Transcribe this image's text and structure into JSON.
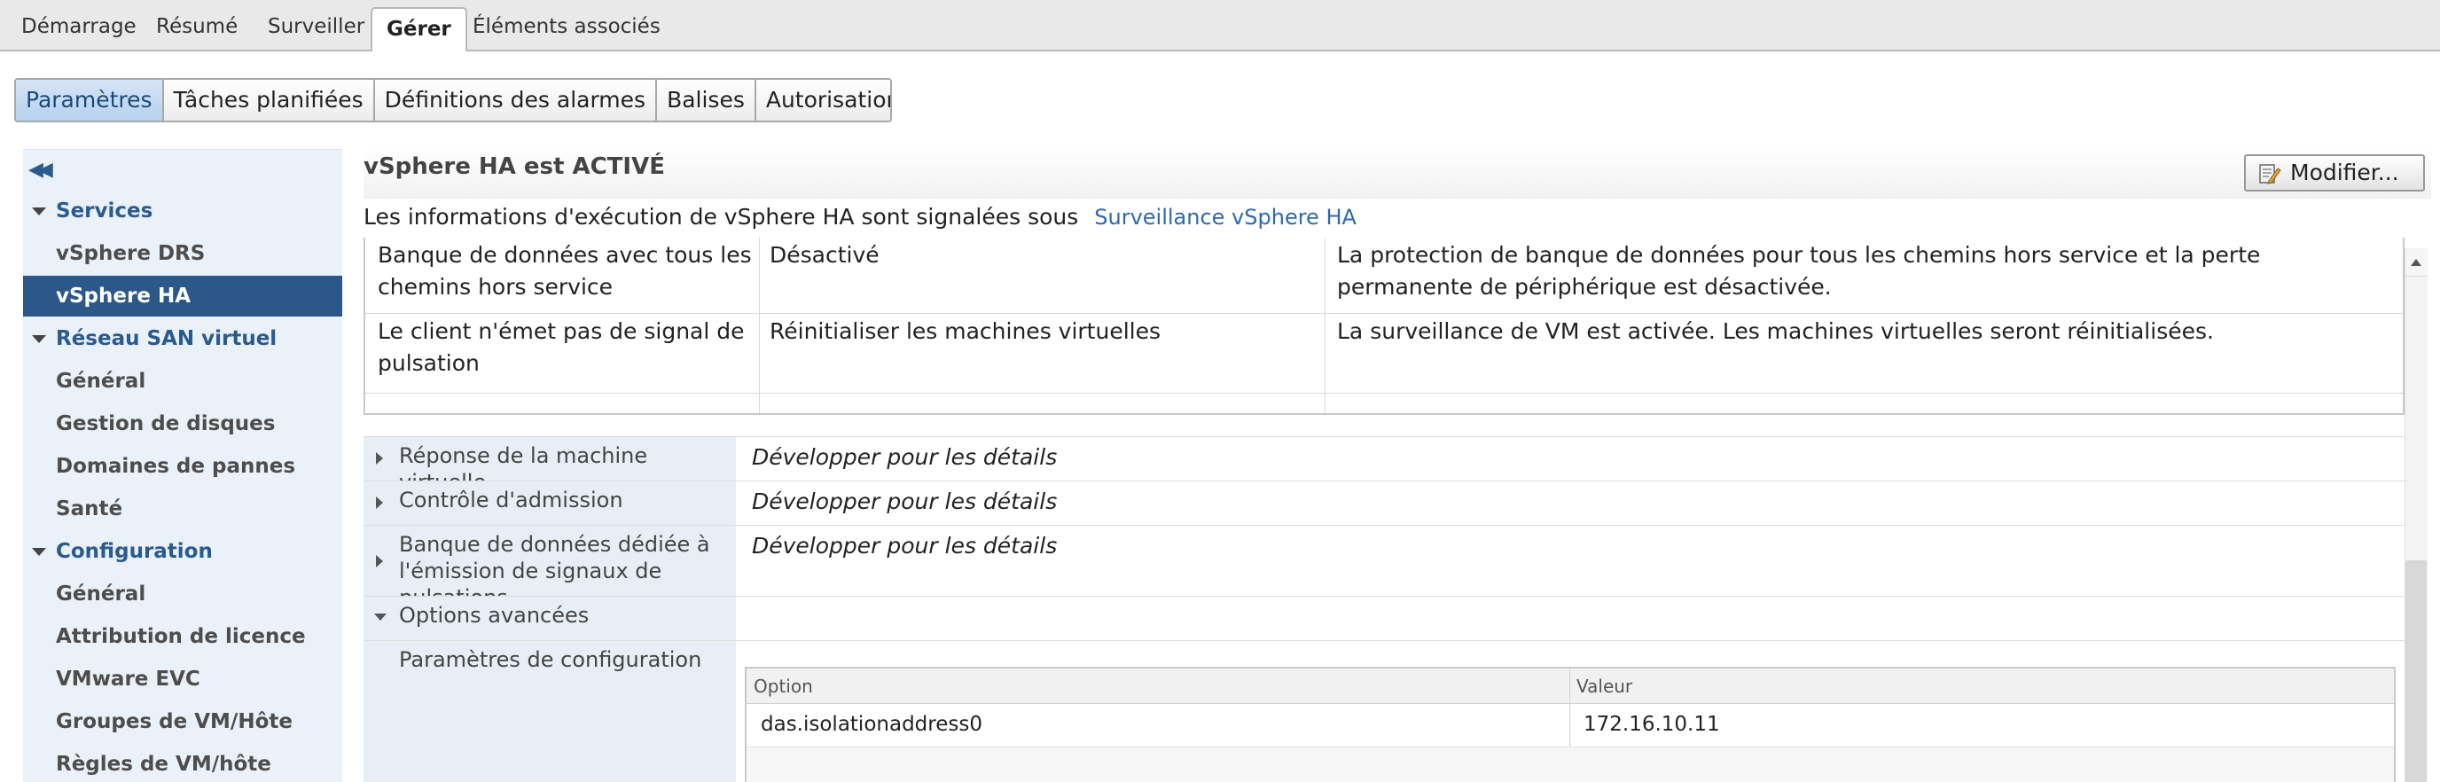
{
  "top_tabs": [
    "Démarrage",
    "Résumé",
    "Surveiller",
    "Gérer",
    "Éléments associés"
  ],
  "active_top_tab": "Gérer",
  "sub_tabs": [
    "Paramètres",
    "Tâches planifiées",
    "Définitions des alarmes",
    "Balises",
    "Autorisations"
  ],
  "active_sub_tab": "Paramètres",
  "sidebar": {
    "collapse_symbol": "◀◀",
    "items": [
      {
        "label": "Services",
        "kind": "group"
      },
      {
        "label": "vSphere DRS",
        "kind": "child"
      },
      {
        "label": "vSphere HA",
        "kind": "child",
        "selected": true
      },
      {
        "label": "Réseau SAN virtuel",
        "kind": "group"
      },
      {
        "label": "Général",
        "kind": "child"
      },
      {
        "label": "Gestion de disques",
        "kind": "child"
      },
      {
        "label": "Domaines de pannes",
        "kind": "child"
      },
      {
        "label": "Santé",
        "kind": "child"
      },
      {
        "label": "Configuration",
        "kind": "group"
      },
      {
        "label": "Général",
        "kind": "child"
      },
      {
        "label": "Attribution de licence",
        "kind": "child"
      },
      {
        "label": "VMware EVC",
        "kind": "child"
      },
      {
        "label": "Groupes de VM/Hôte",
        "kind": "child"
      },
      {
        "label": "Règles de VM/hôte",
        "kind": "child"
      }
    ]
  },
  "header": {
    "title": "vSphere HA est ACTIVÉ",
    "edit_button": "Modifier...",
    "info_text": "Les informations d'exécution de vSphere HA sont signalées sous",
    "info_link": "Surveillance vSphere HA"
  },
  "failure_table": {
    "rows": [
      {
        "condition": "Banque de données avec tous les chemins hors service",
        "response": "Désactivé",
        "details": "La protection de banque de données pour tous les chemins hors service et la perte permanente de périphérique est désactivée."
      },
      {
        "condition": "Le client n'émet pas de signal de pulsation",
        "response": "Réinitialiser les machines virtuelles",
        "details": "La surveillance de VM est activée. Les machines virtuelles seront réinitialisées."
      }
    ]
  },
  "properties": [
    {
      "label": "Réponse de la machine virtuelle",
      "value": "Développer pour les détails",
      "expanded": false
    },
    {
      "label": "Contrôle d'admission",
      "value": "Développer pour les détails",
      "expanded": false
    },
    {
      "label": "Banque de données dédiée à l'émission de signaux de pulsations",
      "value": "Développer pour les détails",
      "expanded": false
    },
    {
      "label": "Options avancées",
      "value": "",
      "expanded": true
    }
  ],
  "advanced_options": {
    "sub_label": "Paramètres de configuration",
    "columns": [
      "Option",
      "Valeur"
    ],
    "rows": [
      {
        "option": "das.isolationaddress0",
        "value": "172.16.10.11"
      }
    ]
  }
}
